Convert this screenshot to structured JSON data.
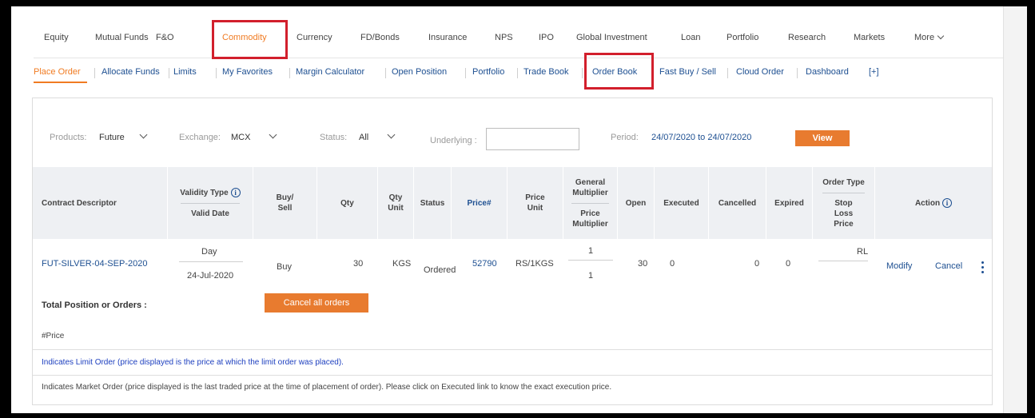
{
  "top_nav": {
    "items": [
      {
        "label": "Equity"
      },
      {
        "label": "Mutual Funds"
      },
      {
        "label": "F&O"
      },
      {
        "label": "Commodity"
      },
      {
        "label": "Currency"
      },
      {
        "label": "FD/Bonds"
      },
      {
        "label": "Insurance"
      },
      {
        "label": "NPS"
      },
      {
        "label": "IPO"
      },
      {
        "label": "Global Investment"
      },
      {
        "label": "Loan"
      },
      {
        "label": "Portfolio"
      },
      {
        "label": "Research"
      },
      {
        "label": "Markets"
      },
      {
        "label": "More"
      }
    ],
    "active": "Commodity"
  },
  "sub_nav": {
    "items": [
      {
        "label": "Place Order"
      },
      {
        "label": "Allocate Funds"
      },
      {
        "label": "Limits"
      },
      {
        "label": "My Favorites"
      },
      {
        "label": "Margin Calculator"
      },
      {
        "label": "Open Position"
      },
      {
        "label": "Portfolio"
      },
      {
        "label": "Trade Book"
      },
      {
        "label": "Order Book"
      },
      {
        "label": "Fast Buy / Sell"
      },
      {
        "label": "Cloud Order"
      },
      {
        "label": "Dashboard"
      },
      {
        "label": "[+]"
      }
    ],
    "active": "Place Order"
  },
  "filters": {
    "products_label": "Products:",
    "products_value": "Future",
    "exchange_label": "Exchange:",
    "exchange_value": "MCX",
    "status_label": "Status:",
    "status_value": "All",
    "underlying_label": "Underlying :",
    "underlying_value": "",
    "period_label": "Period:",
    "period_value": "24/07/2020 to 24/07/2020",
    "view_label": "View"
  },
  "table": {
    "headers": {
      "contract": "Contract Descriptor",
      "validity_type": "Validity Type",
      "valid_date": "Valid Date",
      "buy_sell": "Buy/ Sell",
      "qty": "Qty",
      "qty_unit": "Qty Unit",
      "status": "Status",
      "price": "Price#",
      "price_unit": "Price Unit",
      "general_multiplier": "General Multiplier",
      "price_multiplier": "Price Multiplier",
      "open": "Open",
      "executed": "Executed",
      "cancelled": "Cancelled",
      "expired": "Expired",
      "order_type": "Order Type",
      "stop_loss_price": "Stop Loss Price",
      "action": "Action"
    },
    "rows": [
      {
        "contract": "FUT-SILVER-04-SEP-2020",
        "validity": "Day",
        "valid_date": "24-Jul-2020",
        "buy_sell": "Buy",
        "qty": "30",
        "qty_unit": "KGS",
        "status": "Ordered",
        "price": "52790",
        "price_unit": "RS/1KGS",
        "general_multiplier": "1",
        "price_multiplier": "1",
        "open": "30",
        "executed": "0",
        "cancelled": "0",
        "expired": "0",
        "order_type": "RL",
        "stop_loss_price": "",
        "modify": "Modify",
        "cancel": "Cancel"
      }
    ]
  },
  "total_label": "Total Position or Orders :",
  "cancel_all_label": "Cancel all orders",
  "price_note": "#Price",
  "limit_note": "Indicates Limit Order (price displayed is the price at which the limit order was placed).",
  "market_note": "Indicates Market Order (price displayed is the last traded price at the time of placement of order). Please click on Executed link to know the exact execution price.",
  "colors": {
    "accent": "#f07b22",
    "link": "#1d4f91",
    "highlight_box": "#d21f2c",
    "button": "#e87b2f",
    "header_bg": "#eef0f3"
  }
}
